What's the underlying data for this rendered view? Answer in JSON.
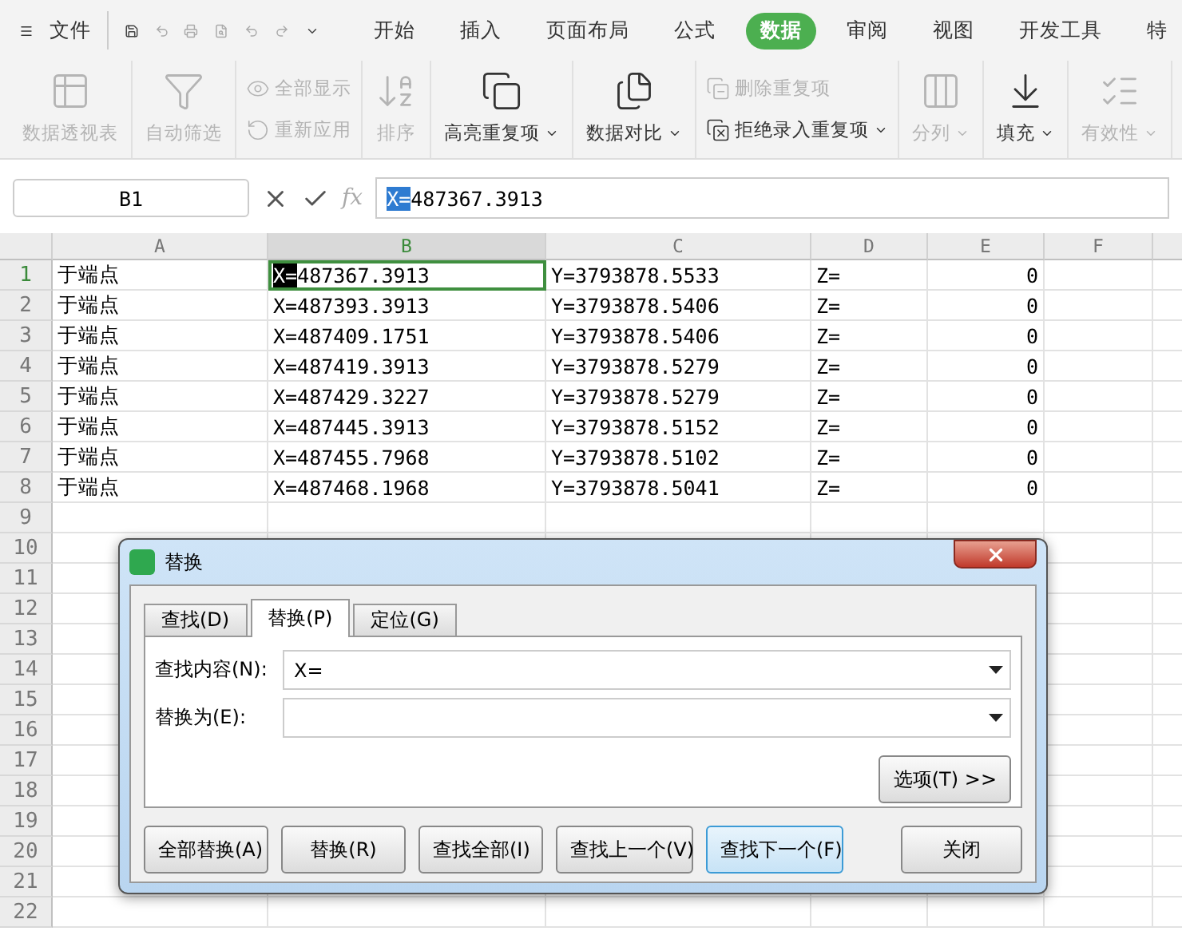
{
  "menu_bar": {
    "file_label": "文件",
    "tabs": [
      {
        "label": "开始",
        "selected": false
      },
      {
        "label": "插入",
        "selected": false
      },
      {
        "label": "页面布局",
        "selected": false
      },
      {
        "label": "公式",
        "selected": false
      },
      {
        "label": "数据",
        "selected": true
      },
      {
        "label": "审阅",
        "selected": false
      },
      {
        "label": "视图",
        "selected": false
      },
      {
        "label": "开发工具",
        "selected": false
      },
      {
        "label": "特",
        "selected": false
      }
    ]
  },
  "ribbon": [
    {
      "kind": "large",
      "label": "数据透视表",
      "disabled": true,
      "dropdown": false
    },
    {
      "kind": "large",
      "label": "自动筛选",
      "disabled": true,
      "dropdown": false
    },
    {
      "kind": "pair",
      "items": [
        {
          "label": "全部显示",
          "disabled": true,
          "dropdown": false
        },
        {
          "label": "重新应用",
          "disabled": true,
          "dropdown": false
        }
      ]
    },
    {
      "kind": "sort",
      "label": "排序",
      "disabled": true,
      "dropdown": false
    },
    {
      "kind": "large",
      "label": "高亮重复项",
      "disabled": false,
      "dropdown": true
    },
    {
      "kind": "large",
      "label": "数据对比",
      "disabled": false,
      "dropdown": true
    },
    {
      "kind": "pair",
      "items": [
        {
          "label": "删除重复项",
          "disabled": true,
          "dropdown": false
        },
        {
          "label": "拒绝录入重复项",
          "disabled": false,
          "dropdown": true
        }
      ]
    },
    {
      "kind": "large",
      "label": "分列",
      "disabled": true,
      "dropdown": true
    },
    {
      "kind": "large",
      "label": "填充",
      "disabled": false,
      "dropdown": true
    },
    {
      "kind": "large",
      "label": "有效性",
      "disabled": true,
      "dropdown": true
    }
  ],
  "formula_bar": {
    "name_box": "B1",
    "function_label": "fx",
    "marked": "X=",
    "text": "487367.3913"
  },
  "columns": [
    {
      "label": "A",
      "selected": false
    },
    {
      "label": "B",
      "selected": true
    },
    {
      "label": "C",
      "selected": false
    },
    {
      "label": "D",
      "selected": false
    },
    {
      "label": "E",
      "selected": false
    },
    {
      "label": "F",
      "selected": false
    }
  ],
  "rows": [
    {
      "number": "1",
      "selected": true,
      "cells": [
        "于端点",
        {
          "marked": "X=",
          "text": "487367.3913"
        },
        "Y=3793878.5533",
        "Z=",
        "0"
      ]
    },
    {
      "number": "2",
      "selected": false,
      "cells": [
        "于端点",
        "X=487393.3913",
        "Y=3793878.5406",
        "Z=",
        "0"
      ]
    },
    {
      "number": "3",
      "selected": false,
      "cells": [
        "于端点",
        "X=487409.1751",
        "Y=3793878.5406",
        "Z=",
        "0"
      ]
    },
    {
      "number": "4",
      "selected": false,
      "cells": [
        "于端点",
        "X=487419.3913",
        "Y=3793878.5279",
        "Z=",
        "0"
      ]
    },
    {
      "number": "5",
      "selected": false,
      "cells": [
        "于端点",
        "X=487429.3227",
        "Y=3793878.5279",
        "Z=",
        "0"
      ]
    },
    {
      "number": "6",
      "selected": false,
      "cells": [
        "于端点",
        "X=487445.3913",
        "Y=3793878.5152",
        "Z=",
        "0"
      ]
    },
    {
      "number": "7",
      "selected": false,
      "cells": [
        "于端点",
        "X=487455.7968",
        "Y=3793878.5102",
        "Z=",
        "0"
      ]
    },
    {
      "number": "8",
      "selected": false,
      "cells": [
        "于端点",
        "X=487468.1968",
        "Y=3793878.5041",
        "Z=",
        "0"
      ]
    },
    {
      "number": "9",
      "selected": false,
      "cells": []
    },
    {
      "number": "10",
      "selected": false,
      "cells": []
    },
    {
      "number": "11",
      "selected": false,
      "cells": []
    },
    {
      "number": "12",
      "selected": false,
      "cells": []
    },
    {
      "number": "13",
      "selected": false,
      "cells": []
    },
    {
      "number": "14",
      "selected": false,
      "cells": []
    },
    {
      "number": "15",
      "selected": false,
      "cells": []
    },
    {
      "number": "16",
      "selected": false,
      "cells": []
    },
    {
      "number": "17",
      "selected": false,
      "cells": []
    },
    {
      "number": "18",
      "selected": false,
      "cells": []
    },
    {
      "number": "19",
      "selected": false,
      "cells": []
    },
    {
      "number": "20",
      "selected": false,
      "cells": []
    },
    {
      "number": "21",
      "selected": false,
      "cells": []
    },
    {
      "number": "22",
      "selected": false,
      "cells": []
    }
  ],
  "dialog": {
    "title": "替换",
    "tabs": [
      {
        "label": "查找(D)",
        "selected": false
      },
      {
        "label": "替换(P)",
        "selected": true
      },
      {
        "label": "定位(G)",
        "selected": false
      }
    ],
    "fields": [
      {
        "label": "查找内容(N):",
        "value": "X="
      },
      {
        "label": "替换为(E):"
      }
    ],
    "options_button": "选项(T) >>",
    "buttons": [
      {
        "label": "全部替换(A)",
        "focused": false
      },
      {
        "label": "替换(R)",
        "focused": false
      },
      {
        "label": "查找全部(I)",
        "focused": false
      },
      {
        "label": "查找上一个(V)",
        "focused": false
      },
      {
        "label": "查找下一个(F)",
        "focused": true
      }
    ],
    "close_button": "关闭"
  }
}
